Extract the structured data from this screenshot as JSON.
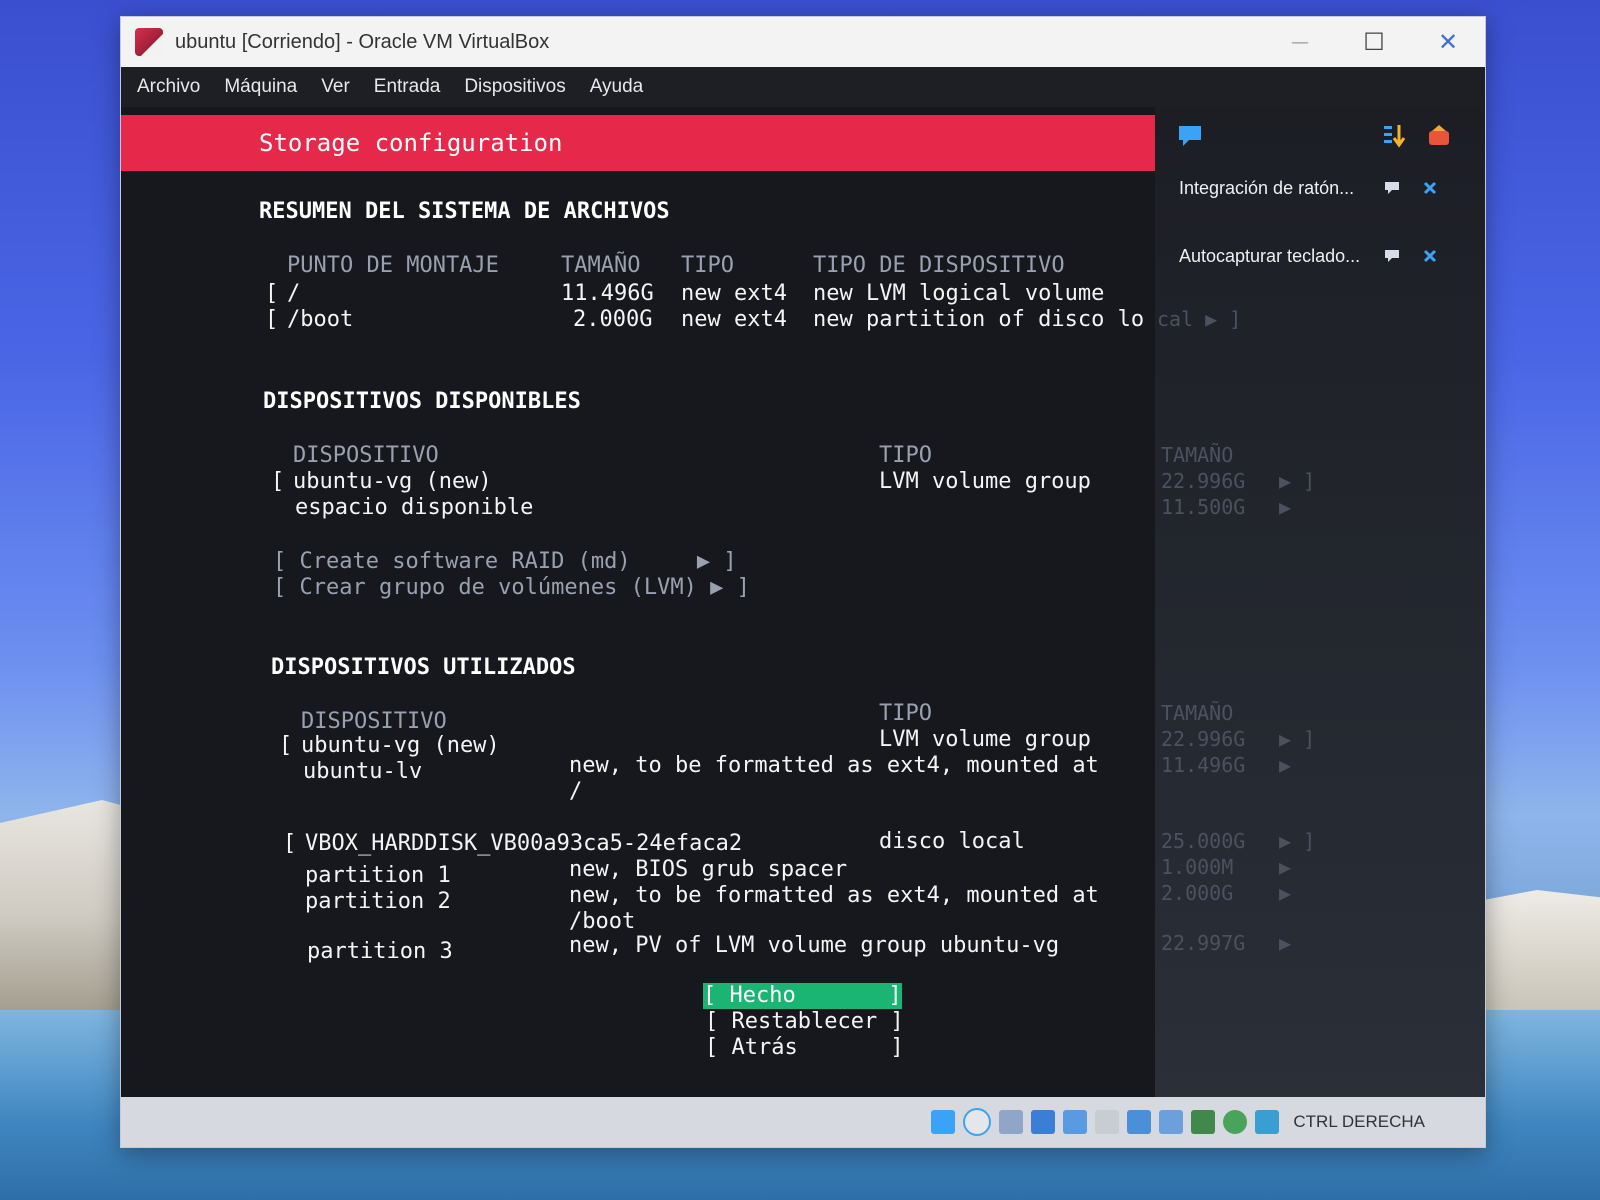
{
  "window": {
    "title": "ubuntu [Corriendo] - Oracle VM VirtualBox",
    "minimize": "—",
    "maximize": "☐",
    "close": "✕"
  },
  "menubar": {
    "items": [
      "Archivo",
      "Máquina",
      "Ver",
      "Entrada",
      "Dispositivos",
      "Ayuda"
    ]
  },
  "installer": {
    "header": "Storage configuration",
    "fs_summary": {
      "heading": "RESUMEN DEL SISTEMA DE ARCHIVOS",
      "col_mount": "PUNTO DE MONTAJE",
      "col_size": "TAMAÑO",
      "col_type": "TIPO",
      "col_devtype": "TIPO DE DISPOSITIVO",
      "rows": [
        {
          "bracket": "[",
          "mount": "/",
          "size": "11.496G",
          "type": "new ext4",
          "devtype": "new LVM logical volume",
          "tail": ""
        },
        {
          "bracket": "[",
          "mount": "/boot",
          "size": "2.000G",
          "type": "new ext4",
          "devtype": "new partition of disco lo",
          "tail": "cal ▶ ]"
        }
      ]
    },
    "available": {
      "heading": "DISPOSITIVOS DISPONIBLES",
      "col_device": "DISPOSITIVO",
      "col_type": "TIPO",
      "col_size": "TAMAÑO",
      "vg_bracket": "[",
      "vg_name": "ubuntu-vg (new)",
      "vg_type": "LVM volume group",
      "vg_size": "22.996G",
      "vg_arrow": "▶ ]",
      "free_label": "espacio disponible",
      "free_size": "11.500G",
      "free_arrow": "▶",
      "action_raid": "[ Create software RAID (md)     ▶ ]",
      "action_lvm": "[ Crear grupo de volúmenes (LVM) ▶ ]"
    },
    "used": {
      "heading": "DISPOSITIVOS UTILIZADOS",
      "col_device": "DISPOSITIVO",
      "col_type": "TIPO",
      "col_size": "TAMAÑO",
      "vg_bracket": "[",
      "vg_name": "ubuntu-vg (new)",
      "vg_type": "LVM volume group",
      "vg_size": "22.996G",
      "vg_arrow": "▶ ]",
      "lv_name": "ubuntu-lv",
      "lv_desc_1": "new, to be formatted as ext4, mounted at",
      "lv_desc_2": "/",
      "lv_size": "11.496G",
      "lv_arrow": "▶",
      "disk_bracket": "[",
      "disk_name": "VBOX_HARDDISK_VB00a93ca5-24efaca2",
      "disk_type": "disco local",
      "disk_size": "25.000G",
      "disk_arrow": "▶ ]",
      "partitions": [
        {
          "name": "partition 1",
          "desc_1": "new, BIOS grub spacer",
          "desc_2": "",
          "size": "1.000M",
          "arrow": "▶"
        },
        {
          "name": "partition 2",
          "desc_1": "new, to be formatted as ext4, mounted at",
          "desc_2": "/boot",
          "size": "2.000G",
          "arrow": "▶"
        },
        {
          "name": "partition 3",
          "desc_1": "new, PV of LVM volume group ubuntu-vg",
          "desc_2": "",
          "size": "22.997G",
          "arrow": "▶"
        }
      ]
    },
    "buttons": {
      "done": "[ Hecho       ]",
      "reset": "[ Restablecer ]",
      "back": "[ Atrás       ]"
    }
  },
  "notifications": {
    "mouse": "Integración de ratón...",
    "keyboard": "Autocapturar teclado..."
  },
  "statusbar": {
    "host_key": "CTRL DERECHA"
  },
  "colors": {
    "header": "#e6294b",
    "selected": "#1ab573",
    "terminal_bg": "#16181d"
  }
}
